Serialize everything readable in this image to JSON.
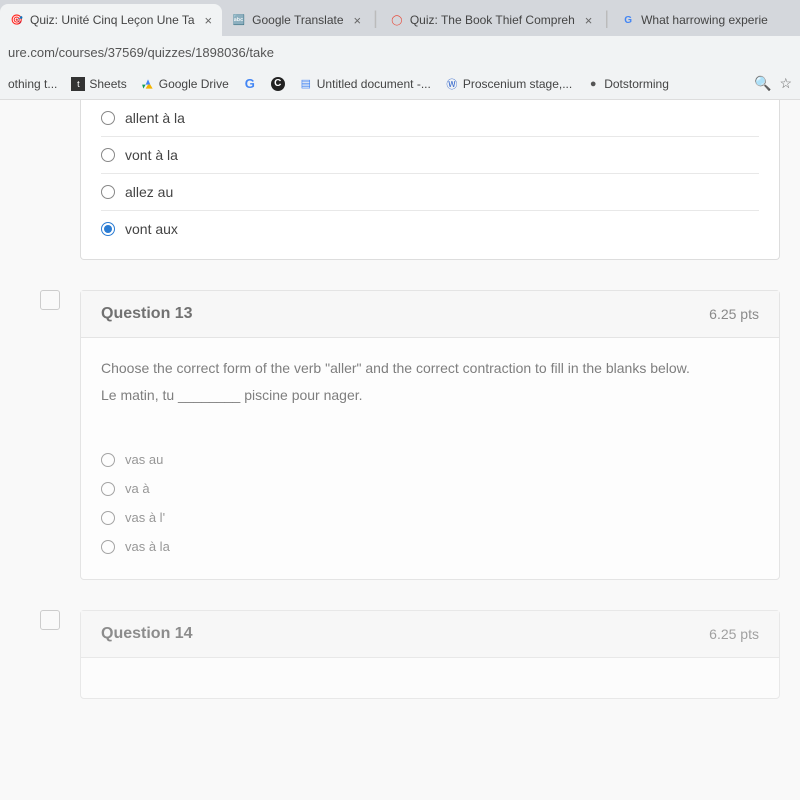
{
  "tabs": [
    {
      "label": "Quiz: Unité Cinq Leçon Une Ta",
      "active": true
    },
    {
      "label": "Google Translate",
      "active": false
    },
    {
      "label": "Quiz: The Book Thief Compreh",
      "active": false
    },
    {
      "label": "What harrowing experie",
      "active": false
    }
  ],
  "url": "ure.com/courses/37569/quizzes/1898036/take",
  "bookmarks": [
    {
      "label": "othing t..."
    },
    {
      "label": "Sheets"
    },
    {
      "label": "Google Drive"
    },
    {
      "label": ""
    },
    {
      "label": ""
    },
    {
      "label": "Untitled document -..."
    },
    {
      "label": "Proscenium stage,..."
    },
    {
      "label": "Dotstorming"
    }
  ],
  "question12": {
    "options": [
      {
        "label": "allent à la",
        "selected": false
      },
      {
        "label": "vont à la",
        "selected": false
      },
      {
        "label": "allez au",
        "selected": false
      },
      {
        "label": "vont aux",
        "selected": true
      }
    ]
  },
  "question13": {
    "title": "Question 13",
    "pts": "6.25 pts",
    "prompt": "Choose the correct form of the verb \"aller\" and the correct contraction to fill in the blanks below.",
    "sentence": "Le matin, tu ________ piscine pour nager.",
    "options": [
      {
        "label": "vas au",
        "selected": false
      },
      {
        "label": "va à",
        "selected": false
      },
      {
        "label": "vas à l'",
        "selected": false
      },
      {
        "label": "vas à la",
        "selected": false
      }
    ]
  },
  "question14": {
    "title": "Question 14",
    "pts": "6.25 pts"
  }
}
